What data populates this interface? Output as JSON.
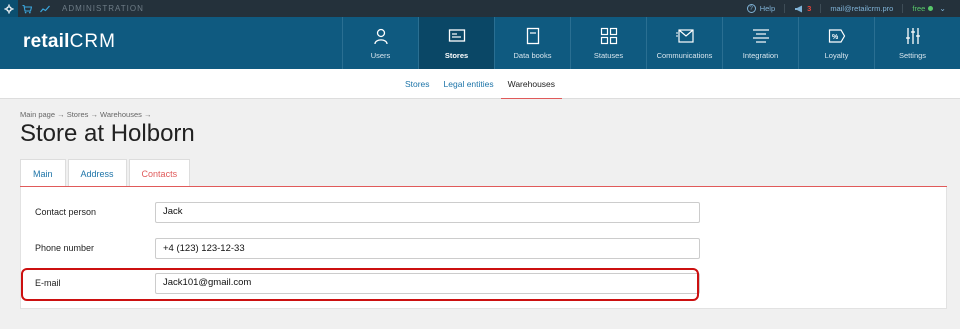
{
  "topbar": {
    "admin_label": "ADMINISTRATION",
    "help_label": "Help",
    "notifications_count": "3",
    "email": "mail@retailcrm.pro",
    "plan": "free",
    "plan_status_color": "#58c86a"
  },
  "logo": {
    "part1": "retail",
    "part2": "CRM"
  },
  "nav": {
    "items": [
      {
        "label": "Users",
        "icon": "user-icon"
      },
      {
        "label": "Stores",
        "icon": "store-icon",
        "active": true
      },
      {
        "label": "Data books",
        "icon": "book-icon"
      },
      {
        "label": "Statuses",
        "icon": "grid-icon"
      },
      {
        "label": "Communications",
        "icon": "mail-icon"
      },
      {
        "label": "Integration",
        "icon": "integration-icon"
      },
      {
        "label": "Loyalty",
        "icon": "percent-icon"
      },
      {
        "label": "Settings",
        "icon": "sliders-icon"
      }
    ]
  },
  "subnav": {
    "items": [
      {
        "label": "Stores"
      },
      {
        "label": "Legal entities"
      },
      {
        "label": "Warehouses",
        "active": true
      }
    ]
  },
  "breadcrumb": "Main page → Stores → Warehouses →",
  "page_title": "Store at Holborn",
  "tabs": [
    {
      "label": "Main"
    },
    {
      "label": "Address"
    },
    {
      "label": "Contacts",
      "active": true
    }
  ],
  "form": {
    "contact_person": {
      "label": "Contact person",
      "value": "Jack"
    },
    "phone": {
      "label": "Phone number",
      "value": "+4 (123) 123-12-33"
    },
    "email": {
      "label": "E-mail",
      "value": "Jack101@gmail.com"
    }
  },
  "colors": {
    "navbar": "#0f5a80",
    "accent_red": "#e05a5a",
    "highlight": "#cc1010",
    "link": "#1d74a8"
  }
}
